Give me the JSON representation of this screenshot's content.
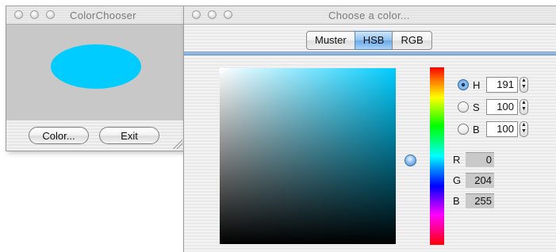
{
  "windows": {
    "color_chooser": {
      "title": "ColorChooser",
      "ellipse_color": "#00ccff",
      "color_button": "Color...",
      "exit_button": "Exit"
    },
    "choose_color": {
      "title": "Choose a color...",
      "tabs": [
        "Muster",
        "HSB",
        "RGB"
      ],
      "active_tab": "HSB",
      "hsb": {
        "h_label": "H",
        "h_value": "191",
        "s_label": "S",
        "s_value": "100",
        "b_label": "B",
        "b_value": "100",
        "selected_mode": "H"
      },
      "rgb": {
        "r_label": "R",
        "r_value": "0",
        "g_label": "G",
        "g_value": "204",
        "b_label": "B",
        "b_value": "255"
      },
      "selected_color": "#00ccff"
    }
  }
}
